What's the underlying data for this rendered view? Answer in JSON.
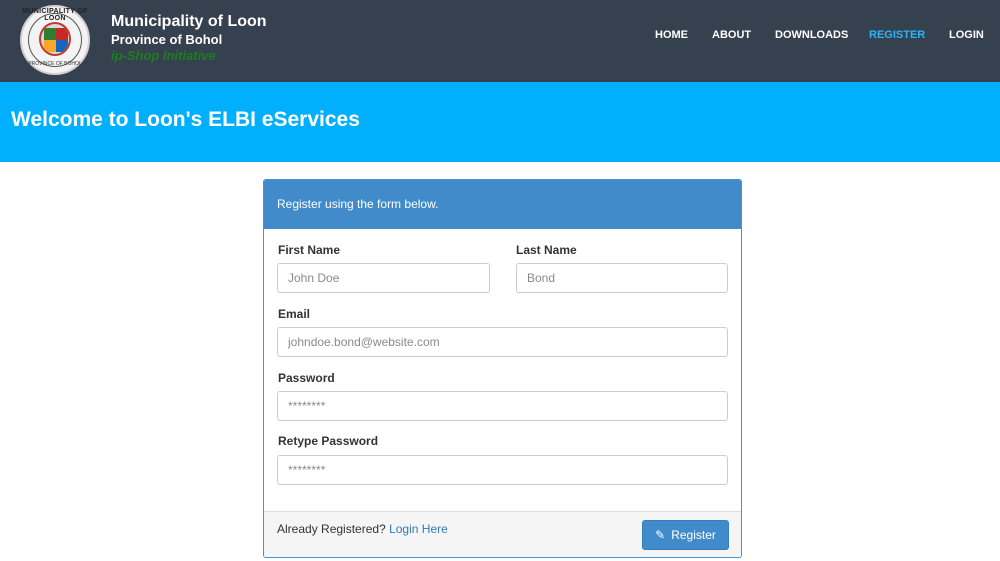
{
  "header": {
    "logo": {
      "icon": "municipal-seal",
      "ring_text_top": "MUNICIPALITY OF LOON",
      "ring_text_bottom": "PROVINCE OF BOHOL"
    },
    "title": "Municipality of Loon",
    "subtitle": "Province of Bohol",
    "tagline": "ip-Shop Initiative",
    "nav": {
      "home": "HOME",
      "about": "ABOUT",
      "downloads": "DOWNLOADS",
      "register": "REGISTER",
      "login": "LOGIN"
    },
    "active_nav": "REGISTER"
  },
  "hero": {
    "title": "Welcome to Loon's ELBI eServices"
  },
  "form": {
    "heading": "Register using the form below.",
    "first_name": {
      "label": "First Name",
      "placeholder": "John Doe",
      "value": ""
    },
    "last_name": {
      "label": "Last Name",
      "placeholder": "Bond",
      "value": ""
    },
    "email": {
      "label": "Email",
      "placeholder": "johndoe.bond@website.com",
      "value": ""
    },
    "password": {
      "label": "Password",
      "placeholder": "********",
      "value": ""
    },
    "retype_password": {
      "label": "Retype Password",
      "placeholder": "********",
      "value": ""
    },
    "footer_text": "Already Registered?",
    "footer_link": "Login Here",
    "submit_label": "Register",
    "submit_icon": "pencil-icon"
  },
  "colors": {
    "navbar": "#364150",
    "hero": "#00b0ff",
    "panel_header": "#428bca",
    "active_nav": "#29b6f6",
    "tagline": "#1e7e1e"
  }
}
